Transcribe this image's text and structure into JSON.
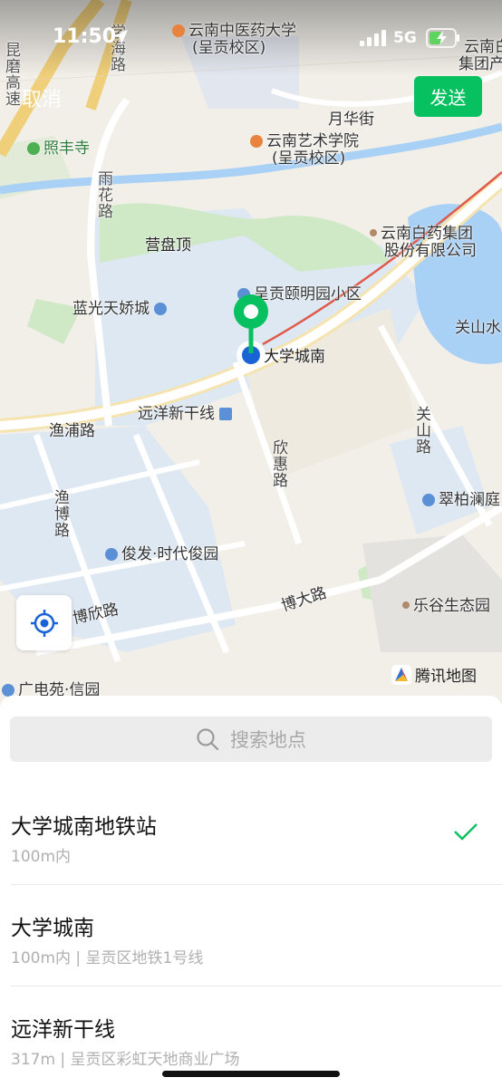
{
  "status_bar": {
    "time": "11:50",
    "network": "5G"
  },
  "nav": {
    "cancel_label": "取消",
    "send_label": "发送"
  },
  "map": {
    "labels": {
      "yunnan_tcm_univ": "云南中医药大学",
      "yunnan_tcm_campus": "(呈贡校区)",
      "xuehai_road": "学海路",
      "group_partial_1": "云南白",
      "group_partial_2": "集团产",
      "highway": "昆磨高速",
      "zhaofeng_temple": "照丰寺",
      "yuehua_street": "月华街",
      "yunnan_arts_univ": "云南艺术学院",
      "yunnan_arts_campus": "(呈贡校区)",
      "yuhua_road": "雨花路",
      "baiyao_group_1": "云南白药集团",
      "baiyao_group_2": "股份有限公司",
      "yingpanding": "营盘顶",
      "chenggong_yiming": "呈贡颐明园小区",
      "languang": "蓝光天娇城",
      "guanshan_water": "关山水",
      "daxuecheng_nan": "大学城南",
      "yuanyang_xinganxian": "远洋新干线",
      "yupu_road": "渔浦路",
      "guanshan_road": "关山路",
      "xinhui_road": "欣惠路",
      "yubo_road": "渔博路",
      "cuibai_lanting": "翠柏澜庭",
      "junfa": "俊发·时代俊园",
      "boxin_road": "博欣路",
      "boda_road": "博大路",
      "legu_park": "乐谷生态园",
      "guangdong_yuan": "广电苑·信园"
    },
    "brand": "腾讯地图",
    "locate_icon": "crosshair-icon"
  },
  "search": {
    "placeholder": "搜索地点"
  },
  "results": [
    {
      "name": "大学城南地铁站",
      "subtitle": "100m内",
      "selected": true
    },
    {
      "name": "大学城南",
      "subtitle": "100m内 | 呈贡区地铁1号线",
      "selected": false
    },
    {
      "name": "远洋新干线",
      "subtitle": "317m | 呈贡区彩虹天地商业广场",
      "selected": false
    }
  ],
  "colors": {
    "accent": "#07c160",
    "check": "#07c160",
    "pin_blue": "#1a63d6",
    "water": "#a9d0f5",
    "green_area": "#cfe9c7",
    "residential": "#dde8f3"
  }
}
